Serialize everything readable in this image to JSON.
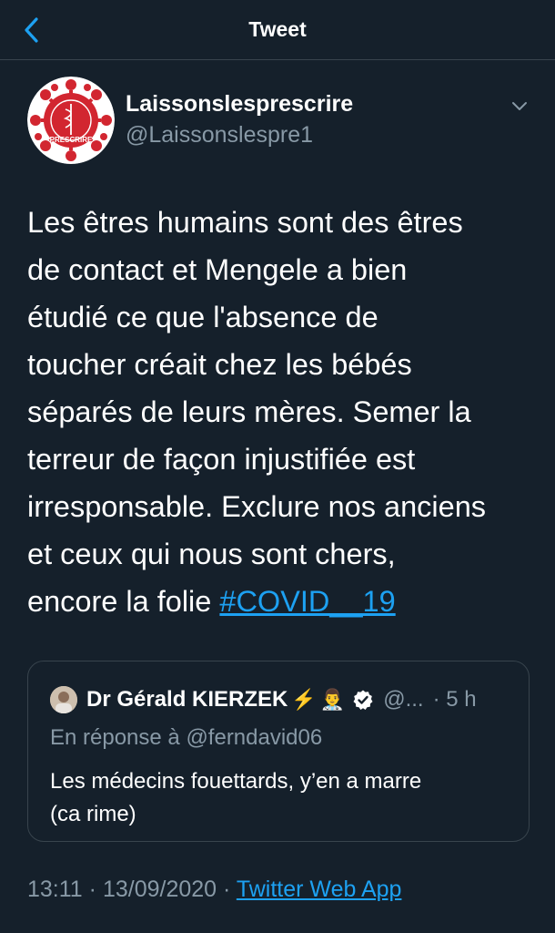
{
  "header": {
    "title": "Tweet",
    "back_icon": "chevron-left-icon"
  },
  "author": {
    "name": "Laissonslesprescrire",
    "handle": "@Laissonslespre1",
    "avatar_text_top": "Laissons les médecins",
    "avatar_text_bottom": "PRESCRIRE",
    "avatar_color": "#d22630",
    "more_icon": "chevron-down-icon"
  },
  "tweet": {
    "text": "Les êtres humains sont des êtres\nde contact et Mengele a bien\nétudié ce que l'absence de\ntoucher créait chez les bébés\nséparés de leurs mères. Semer la\nterreur de façon injustifiée est\nirresponsable. Exclure nos anciens\net ceux qui nous sont chers,\nencore la folie ",
    "hashtag": "#COVID__19"
  },
  "quoted_tweet": {
    "author_name": "Dr Gérald KIERZEK",
    "emoji_1": "⚡",
    "emoji_2": "👨‍⚕️",
    "handle": "@...",
    "time": "· 5 h",
    "reply_to": "En réponse à @ferndavid06",
    "text": "Les médecins fouettards, y’en a marre\n(ca rime)"
  },
  "footer": {
    "time": "13:11",
    "date": "13/09/2020",
    "separator": "·",
    "source": "Twitter Web App"
  },
  "colors": {
    "background": "#15202b",
    "border": "#38444d",
    "secondary_text": "#8899a6",
    "link": "#1da1f2"
  }
}
